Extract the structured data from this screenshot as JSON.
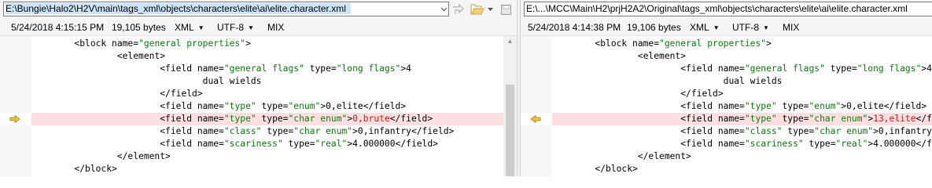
{
  "left": {
    "path": "E:\\Bungie\\Halo2\\H2V\\main\\tags_xml\\objects\\characters\\elite\\ai\\elite.character.xml",
    "toolbar": {
      "dropdown_icon": "chevron-down-icon",
      "next_icon": "navigate-arrow-icon",
      "folder_icon": "open-folder-icon",
      "save_icon": "save-disk-icon"
    },
    "info": {
      "timestamp": "5/24/2018 4:15:15 PM",
      "size": "19,105 bytes",
      "format": "XML",
      "encoding": "UTF-8",
      "line_endings": "MIX"
    },
    "lines": [
      {
        "indent": "        ",
        "parts": [
          [
            "tag",
            "<block "
          ],
          [
            "an",
            "name="
          ],
          [
            "av",
            "\"general properties\""
          ],
          [
            "tag",
            ">"
          ]
        ]
      },
      {
        "indent": "                ",
        "parts": [
          [
            "tag",
            "<element>"
          ]
        ]
      },
      {
        "indent": "                        ",
        "parts": [
          [
            "tag",
            "<field "
          ],
          [
            "an",
            "name="
          ],
          [
            "av",
            "\"general flags\""
          ],
          [
            "an",
            " type="
          ],
          [
            "av",
            "\"long flags\""
          ],
          [
            "tag",
            ">"
          ],
          [
            "tx",
            "4"
          ]
        ]
      },
      {
        "indent": "                                ",
        "parts": [
          [
            "tx",
            "dual wields"
          ]
        ]
      },
      {
        "indent": "                        ",
        "parts": [
          [
            "tag",
            "</field>"
          ]
        ]
      },
      {
        "indent": "                        ",
        "parts": [
          [
            "tag",
            "<field "
          ],
          [
            "an",
            "name="
          ],
          [
            "av",
            "\"type\""
          ],
          [
            "an",
            " type="
          ],
          [
            "av",
            "\"enum\""
          ],
          [
            "tag",
            ">"
          ],
          [
            "tx",
            "0,elite"
          ],
          [
            "tag",
            "</field>"
          ]
        ]
      },
      {
        "indent": "                        ",
        "diff": true,
        "parts": [
          [
            "tag",
            "<field "
          ],
          [
            "an",
            "name="
          ],
          [
            "av",
            "\"type\""
          ],
          [
            "an",
            " type="
          ],
          [
            "av",
            "\"char enum\""
          ],
          [
            "tag",
            ">"
          ],
          [
            "dt",
            "0,brute"
          ],
          [
            "tag",
            "</field>"
          ]
        ]
      },
      {
        "indent": "                        ",
        "parts": [
          [
            "tag",
            "<field "
          ],
          [
            "an",
            "name="
          ],
          [
            "av",
            "\"class\""
          ],
          [
            "an",
            " type="
          ],
          [
            "av",
            "\"char enum\""
          ],
          [
            "tag",
            ">"
          ],
          [
            "tx",
            "0,infantry"
          ],
          [
            "tag",
            "</field>"
          ]
        ]
      },
      {
        "indent": "                        ",
        "parts": [
          [
            "tag",
            "<field "
          ],
          [
            "an",
            "name="
          ],
          [
            "av",
            "\"scariness\""
          ],
          [
            "an",
            " type="
          ],
          [
            "av",
            "\"real\""
          ],
          [
            "tag",
            ">"
          ],
          [
            "tx",
            "4.000000"
          ],
          [
            "tag",
            "</field>"
          ]
        ]
      },
      {
        "indent": "                ",
        "parts": [
          [
            "tag",
            "</element>"
          ]
        ]
      },
      {
        "indent": "        ",
        "parts": [
          [
            "tag",
            "</block>"
          ]
        ]
      }
    ]
  },
  "right": {
    "path": "E:\\...\\MCC\\Main\\H2\\prjH2A2\\Original\\tags_xml\\objects\\characters\\elite\\ai\\elite.character.xml",
    "info": {
      "timestamp": "5/24/2018 4:14:38 PM",
      "size": "19,106 bytes",
      "format": "XML",
      "encoding": "UTF-8",
      "line_endings": "MIX"
    },
    "lines": [
      {
        "indent": "        ",
        "parts": [
          [
            "tag",
            "<block "
          ],
          [
            "an",
            "name="
          ],
          [
            "av",
            "\"general properties\""
          ],
          [
            "tag",
            ">"
          ]
        ]
      },
      {
        "indent": "                ",
        "parts": [
          [
            "tag",
            "<element>"
          ]
        ]
      },
      {
        "indent": "                        ",
        "parts": [
          [
            "tag",
            "<field "
          ],
          [
            "an",
            "name="
          ],
          [
            "av",
            "\"general flags\""
          ],
          [
            "an",
            " type="
          ],
          [
            "av",
            "\"long flags\""
          ],
          [
            "tag",
            ">"
          ],
          [
            "tx",
            "4"
          ]
        ]
      },
      {
        "indent": "                                ",
        "parts": [
          [
            "tx",
            "dual wields"
          ]
        ]
      },
      {
        "indent": "                        ",
        "parts": [
          [
            "tag",
            "</field>"
          ]
        ]
      },
      {
        "indent": "                        ",
        "parts": [
          [
            "tag",
            "<field "
          ],
          [
            "an",
            "name="
          ],
          [
            "av",
            "\"type\""
          ],
          [
            "an",
            " type="
          ],
          [
            "av",
            "\"enum\""
          ],
          [
            "tag",
            ">"
          ],
          [
            "tx",
            "0,elite"
          ],
          [
            "tag",
            "</field>"
          ]
        ]
      },
      {
        "indent": "                        ",
        "diff": true,
        "parts": [
          [
            "tag",
            "<field "
          ],
          [
            "an",
            "name="
          ],
          [
            "av",
            "\"type\""
          ],
          [
            "an",
            " type="
          ],
          [
            "av",
            "\"char enum\""
          ],
          [
            "tag",
            ">"
          ],
          [
            "dt",
            "13,elite"
          ],
          [
            "tag",
            "</field>"
          ]
        ]
      },
      {
        "indent": "                        ",
        "parts": [
          [
            "tag",
            "<field "
          ],
          [
            "an",
            "name="
          ],
          [
            "av",
            "\"class\""
          ],
          [
            "an",
            " type="
          ],
          [
            "av",
            "\"char enum\""
          ],
          [
            "tag",
            ">"
          ],
          [
            "tx",
            "0,infantry"
          ],
          [
            "tag",
            "</field>"
          ]
        ]
      },
      {
        "indent": "                        ",
        "parts": [
          [
            "tag",
            "<field "
          ],
          [
            "an",
            "name="
          ],
          [
            "av",
            "\"scariness\""
          ],
          [
            "an",
            " type="
          ],
          [
            "av",
            "\"real\""
          ],
          [
            "tag",
            ">"
          ],
          [
            "tx",
            "4.000000"
          ],
          [
            "tag",
            "</field>"
          ]
        ]
      },
      {
        "indent": "                ",
        "parts": [
          [
            "tag",
            "</element>"
          ]
        ]
      },
      {
        "indent": "        ",
        "parts": [
          [
            "tag",
            "</block>"
          ]
        ]
      }
    ]
  },
  "colors": {
    "diff_background": "#ffe0e0",
    "diff_text": "#e01010",
    "attribute_value": "#0e7a0e",
    "diff_arrow": "#e8c33a",
    "path_selection": "#cce4f7"
  }
}
